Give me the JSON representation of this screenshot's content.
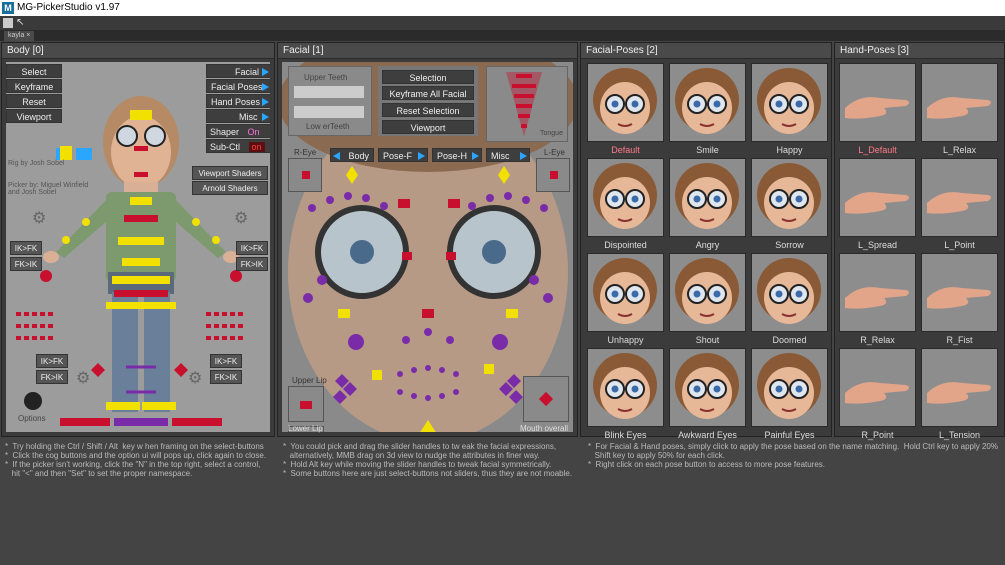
{
  "app": {
    "title": "MG-PickerStudio v1.97",
    "logo": "M",
    "tab": "kayla"
  },
  "body_panel": {
    "title": "Body [0]",
    "left_buttons": [
      "Select",
      "Keyframe",
      "Reset",
      "Viewport"
    ],
    "right_buttons": [
      "Facial",
      "Facial Poses",
      "Hand Poses",
      "Misc"
    ],
    "shaper_label": "Shaper",
    "shaper_value": "On",
    "subctl_label": "Sub-Ctl",
    "subctl_value": "on",
    "rig_credit": "Rig by Josh Sobel",
    "picker_credit": "Picker by: Miguel Winfield\nand Josh Sobel",
    "viewport_shaders": "Viewport Shaders",
    "arnold_shaders": "Arnold Shaders",
    "ikfk": "IK>FK",
    "fkik": "FK>IK",
    "options": "Options"
  },
  "facial_panel": {
    "title": "Facial [1]",
    "upper_teeth": "Upper Teeth",
    "lower_teeth": "Low erTeeth",
    "buttons": [
      "Selection",
      "Keyframe All Facial",
      "Reset Selection",
      "Viewport"
    ],
    "tongue": "Tongue",
    "r_eye": "R-Eye",
    "l_eye": "L-Eye",
    "nav": [
      "Body",
      "Pose-F",
      "Pose-H",
      "Misc"
    ],
    "upper_lip": "Upper Lip",
    "lower_lip": "Lower Lip",
    "mouth_overall": "Mouth overall"
  },
  "facial_poses": {
    "title": "Facial-Poses [2]",
    "items": [
      "Default",
      "Smile",
      "Happy",
      "Dispointed",
      "Angry",
      "Sorrow",
      "Unhappy",
      "Shout",
      "Doomed",
      "Blink Eyes",
      "Awkward Eyes",
      "Painful Eyes"
    ]
  },
  "hand_poses": {
    "title": "Hand-Poses [3]",
    "items": [
      "L_Default",
      "L_Relax",
      "L_Spread",
      "L_Point",
      "R_Relax",
      "R_Fist",
      "R_Point",
      "L_Tension"
    ]
  },
  "notes": {
    "body": "*  Try holding the Ctrl / Shift / Alt  key w hen framing on the select-buttons\n*  Click the cog buttons and the option ui will pops up, click again to close.\n*  If the picker isn't working, click the \"N\" in the top right, select a control,\n   hit \"<\" and then \"Set\" to set the proper namespace.",
    "facial": "*  You could pick and drag the slider handles to tw eak the facial expressions,\n   alternatively, MMB drag on 3d view to nudge the attributes in finer way.\n*  Hold Alt key while moving the slider handles to tweak facial symmetrically.\n*  Some buttons here are just select-buttons not sliders, thus they are not moable.",
    "poses": "*  For Facial & Hand poses, simply click to apply the pose based on the name matching.  Hold Ctrl key to apply 20%\n   Shift key to apply 50% for each click.\n*  Right click on each pose button to access to more pose features."
  },
  "colors": {
    "accent": "#2aa6ff",
    "red": "#c8102e",
    "yellow": "#f2e100",
    "purple": "#7a2ca8",
    "pink_label": "#ff7a8a"
  }
}
